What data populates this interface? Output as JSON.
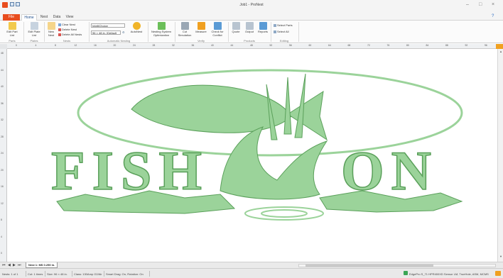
{
  "window": {
    "title": "Job1 - ProNest",
    "minimize": "–",
    "maximize": "□",
    "close": "×"
  },
  "tabs": {
    "file": "File",
    "home": "Home",
    "nest": "Nest",
    "data": "Data",
    "view": "View"
  },
  "ribbon": {
    "parts": {
      "edit_part_list": "Edit Part List",
      "group": "Parts"
    },
    "plates": {
      "edit_plate_list": "Edit Plate List",
      "group": "Plates"
    },
    "nests": {
      "new_nest": "New Nest",
      "clear_nest": "Clear Nest",
      "delete_nest": "Delete Nest",
      "delete_all_nests": "Delete All Nests",
      "group": "Nests"
    },
    "auto": {
      "strategy": "IntelliChoice",
      "plate_size": "96 × 48 in. (Default",
      "autonest": "AutoNest",
      "group": "Automatic Nesting"
    },
    "sequence": {
      "nesting_system_optimization": "Nesting System Optimization"
    },
    "verify": {
      "cut_simulation": "Cut Simulation",
      "measure": "Measure",
      "check_for_conflict": "Check for Conflict",
      "group": "Verify"
    },
    "products": {
      "quote": "Quote",
      "output": "Output",
      "reports": "Reports",
      "group": "Products"
    },
    "editing": {
      "select_parts": "Select Parts",
      "select_all": "Select All",
      "group": "Editing"
    }
  },
  "rulers": {
    "horizontal": [
      "0",
      "4",
      "8",
      "12",
      "16",
      "20",
      "24",
      "28",
      "32",
      "36",
      "40",
      "44",
      "48",
      "52",
      "56",
      "60",
      "64",
      "68",
      "72",
      "76",
      "80",
      "84",
      "88",
      "92",
      "96"
    ],
    "vertical": [
      "48",
      "44",
      "40",
      "36",
      "32",
      "28",
      "24",
      "20",
      "16",
      "12",
      "8",
      "4",
      "0"
    ]
  },
  "canvas": {
    "artwork_text_left": "FISH",
    "artwork_text_right": "ON",
    "part_color": "#9bd39a",
    "part_stroke": "#5aa05a"
  },
  "sheet": {
    "tab_label": "Nest 1: MS 0.250 in."
  },
  "status": {
    "nests": "Nests: 1 of 1",
    "cut": "Cut: 1 times",
    "size": "Size: 96 × 48 in.",
    "class": "Class: 130Amp O2/Air",
    "smart_drag": "Smart Drag: On, Rotation: On",
    "machine": "EdgePro S_71 HPR400XD Sensor LM, TrueHole, ASM, MCMS"
  }
}
